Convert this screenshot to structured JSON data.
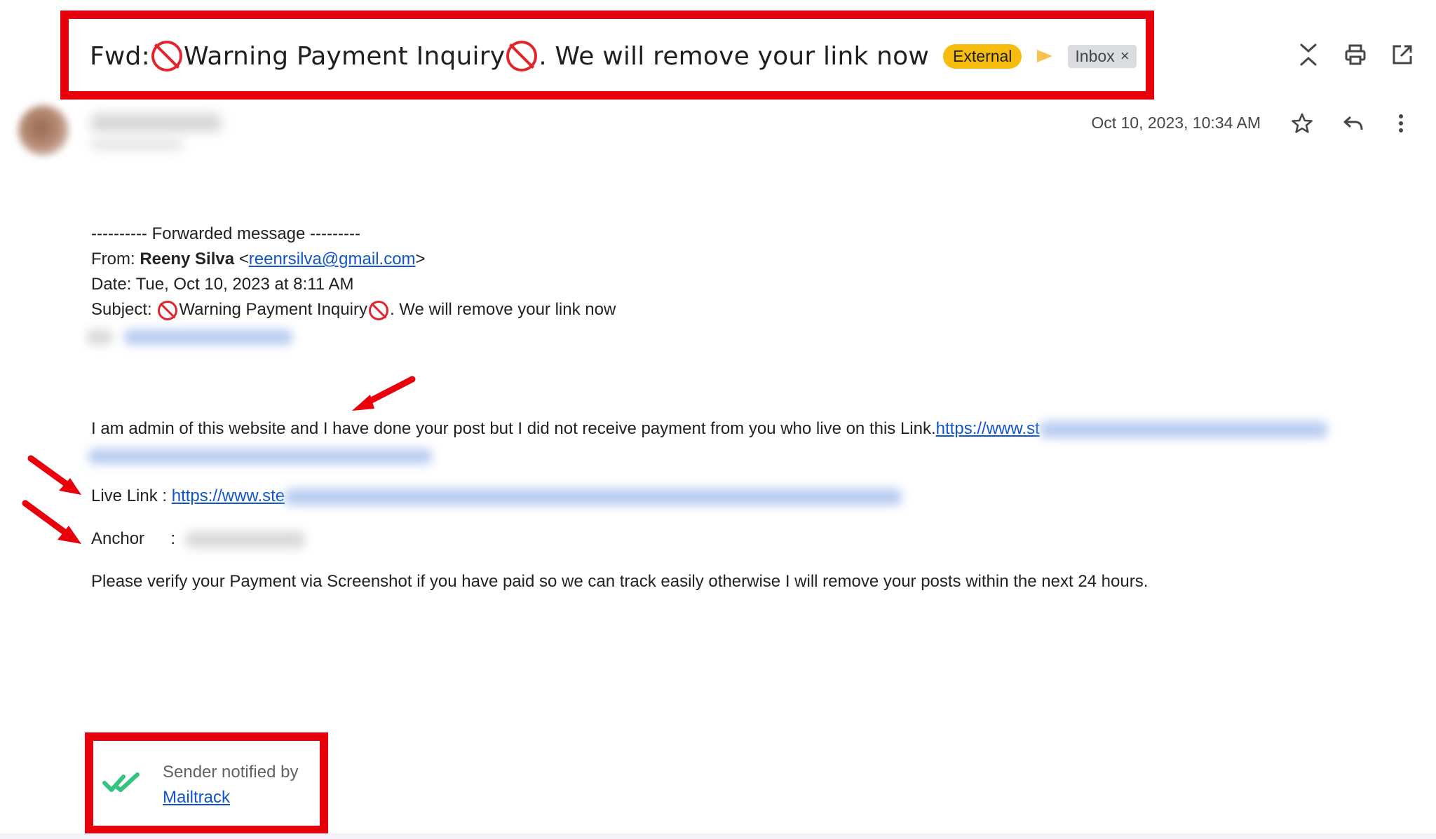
{
  "header": {
    "subject_prefix": "Fwd: ",
    "subject_part1": "Warning Payment Inquiry",
    "subject_part2": ". We will remove your link now",
    "label_external": "External",
    "label_inbox": "Inbox",
    "label_inbox_close": "×"
  },
  "toolbar": {
    "icons": [
      "collapse-icon",
      "print-icon",
      "open-in-new-window-icon"
    ]
  },
  "message": {
    "date": "Oct 10, 2023, 10:34 AM",
    "actions": [
      "star-icon",
      "reply-icon",
      "more-vert-icon"
    ]
  },
  "forwarded": {
    "divider": "---------- Forwarded message ---------",
    "from_label": "From: ",
    "from_name": "Reeny Silva",
    "from_email_open": " <",
    "from_email": "reenrsilva@gmail.com",
    "from_email_close": ">",
    "date_line": "Date: Tue, Oct 10, 2023 at 8:11 AM",
    "subject_label": "Subject: ",
    "subject_part1": "Warning Payment Inquiry",
    "subject_part2": ". We will remove your link now"
  },
  "body": {
    "paragraph1_text": "I am admin of this website and I have done your post but I did  not receive payment from you who live on this Link.",
    "paragraph1_link": "https://www.st",
    "live_link_label": "Live Link : ",
    "live_link_url": "https://www.ste",
    "anchor_label": "Anchor",
    "anchor_colon": ":",
    "paragraph2": "Please verify your Payment via Screenshot if you have paid so we can track easily otherwise I will remove your posts within the next 24 hours."
  },
  "mailtrack": {
    "notified_text": "Sender notified by",
    "link_text": "Mailtrack"
  },
  "colors": {
    "highlight_frame": "#e8000b",
    "external_badge": "#f6bd0f",
    "link": "#1155cc",
    "mailtrack_check": "#33c481"
  }
}
